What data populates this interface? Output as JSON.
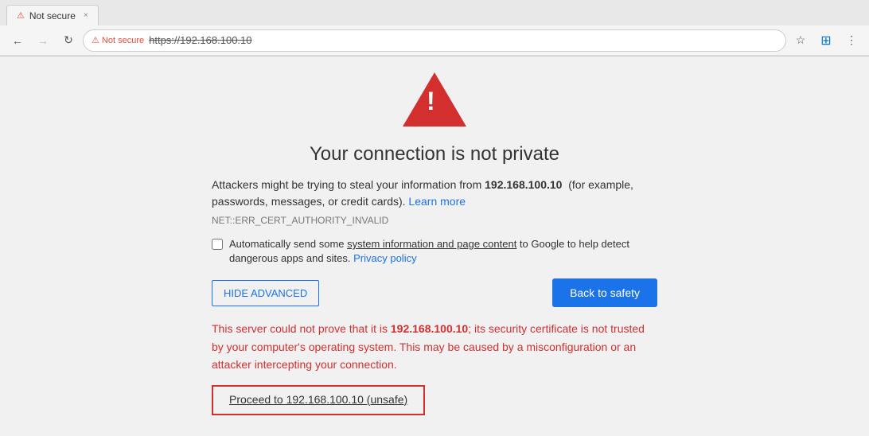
{
  "browser": {
    "tab": {
      "favicon_label": "⚠",
      "title": "Not secure",
      "close_label": "×"
    },
    "nav": {
      "back_label": "←",
      "forward_label": "→",
      "refresh_label": "↻",
      "security_warning": "⚠ Not secure",
      "url": "https://192.168.100.10",
      "star_label": "☆",
      "windows_label": "⊞",
      "menu_label": "⋮"
    }
  },
  "page": {
    "warning_icon_label": "!",
    "title": "Your connection is not private",
    "description_part1": "Attackers might be trying to steal your information from ",
    "description_host": "192.168.100.10",
    "description_part2": "  (for example, passwords, messages, or credit cards). ",
    "learn_more_label": "Learn more",
    "error_code": "NET::ERR_CERT_AUTHORITY_INVALID",
    "checkbox_text_before": "Automatically send some ",
    "checkbox_link_text": "system information and page content",
    "checkbox_text_after": " to Google to help detect dangerous apps and sites. ",
    "privacy_policy_label": "Privacy policy",
    "hide_advanced_label": "HIDE ADVANCED",
    "back_to_safety_label": "Back to safety",
    "advanced_text_part1": "This server could not prove that it is ",
    "advanced_host": "192.168.100.10",
    "advanced_text_part2": "; its security certificate is not trusted by your computer's operating system. This may be caused by a misconfiguration or an attacker intercepting your connection.",
    "proceed_label": "Proceed to 192.168.100.10 (unsafe)"
  }
}
